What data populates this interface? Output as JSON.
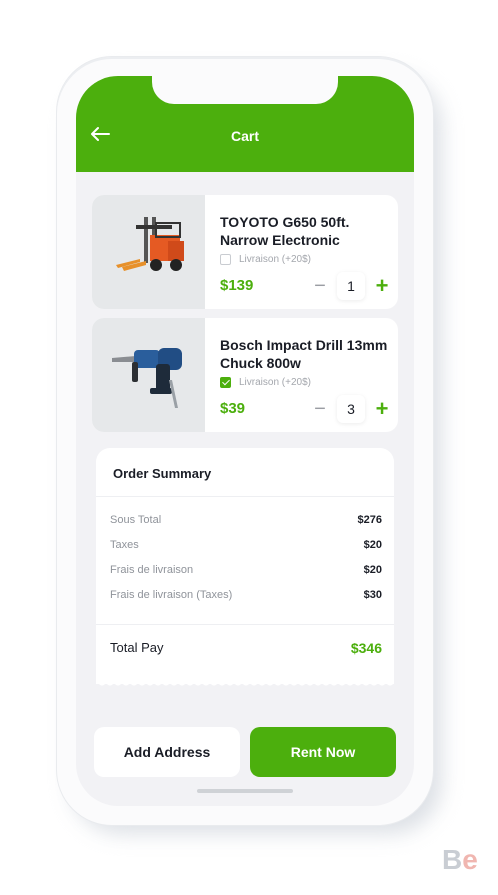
{
  "header": {
    "title": "Cart",
    "back_icon": "arrow-left-icon",
    "color": "#4caf0d"
  },
  "items": [
    {
      "name": "TOYOTO G650 50ft. Narrow Electronic",
      "option_label": "Livraison (+20$)",
      "option_checked": false,
      "price": "$139",
      "quantity": "1",
      "image": "forklift"
    },
    {
      "name": "Bosch Impact Drill 13mm Chuck 800w",
      "option_label": "Livraison (+20$)",
      "option_checked": true,
      "price": "$39",
      "quantity": "3",
      "image": "drill"
    }
  ],
  "summary": {
    "title": "Order Summary",
    "rows": [
      {
        "label": "Sous Total",
        "value": "$276"
      },
      {
        "label": "Taxes",
        "value": "$20"
      },
      {
        "label": "Frais de livraison",
        "value": "$20"
      },
      {
        "label": "Frais de livraison (Taxes)",
        "value": "$30"
      }
    ],
    "total_label": "Total Pay",
    "total_value": "$346"
  },
  "actions": {
    "add_address": "Add Address",
    "rent_now": "Rent Now"
  },
  "watermark": "Be"
}
